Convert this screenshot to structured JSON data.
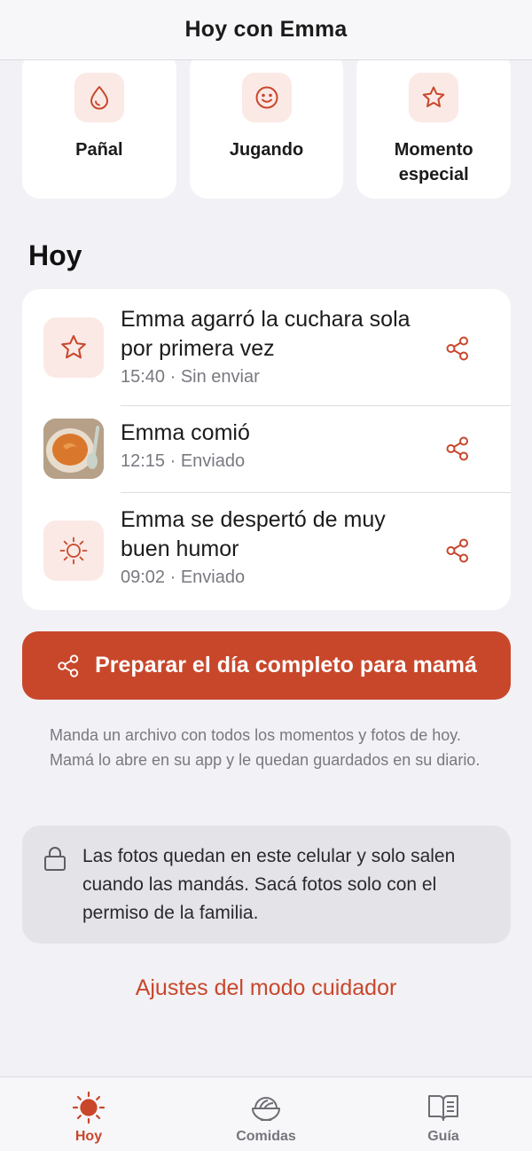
{
  "header": {
    "title": "Hoy con Emma"
  },
  "quick_actions": [
    {
      "label": "Pañal",
      "icon": "drop-icon"
    },
    {
      "label": "Jugando",
      "icon": "smile-icon"
    },
    {
      "label": "Momento especial",
      "icon": "star-icon"
    }
  ],
  "section": {
    "title": "Hoy"
  },
  "moments": [
    {
      "title": "Emma agarró la cuchara sola por primera vez",
      "time": "15:40 · Sin enviar",
      "icon": "star-icon"
    },
    {
      "title": "Emma comió",
      "time": "12:15 · Enviado",
      "icon": "food-photo"
    },
    {
      "title": "Emma se despertó de muy buen humor",
      "time": "09:02 · Enviado",
      "icon": "sun-icon"
    }
  ],
  "primary_button": {
    "label": "Preparar el día completo para mamá",
    "icon": "share-icon"
  },
  "helper_text": "Manda un archivo con todos los momentos y fotos de hoy. Mamá lo abre en su app y le quedan guardados en su diario.",
  "privacy_notice": {
    "text": "Las fotos quedan en este celular y solo salen cuando las mandás. Sacá fotos solo con el permiso de la familia.",
    "icon": "lock-icon"
  },
  "settings_link": "Ajustes del modo cuidador",
  "tabs": [
    {
      "label": "Hoy",
      "icon": "sun-icon",
      "active": true
    },
    {
      "label": "Comidas",
      "icon": "bowl-icon",
      "active": false
    },
    {
      "label": "Guía",
      "icon": "book-icon",
      "active": false
    }
  ],
  "colors": {
    "accent": "#c8472b",
    "accent_soft": "#fbe9e6",
    "background": "#f2f1f5"
  }
}
